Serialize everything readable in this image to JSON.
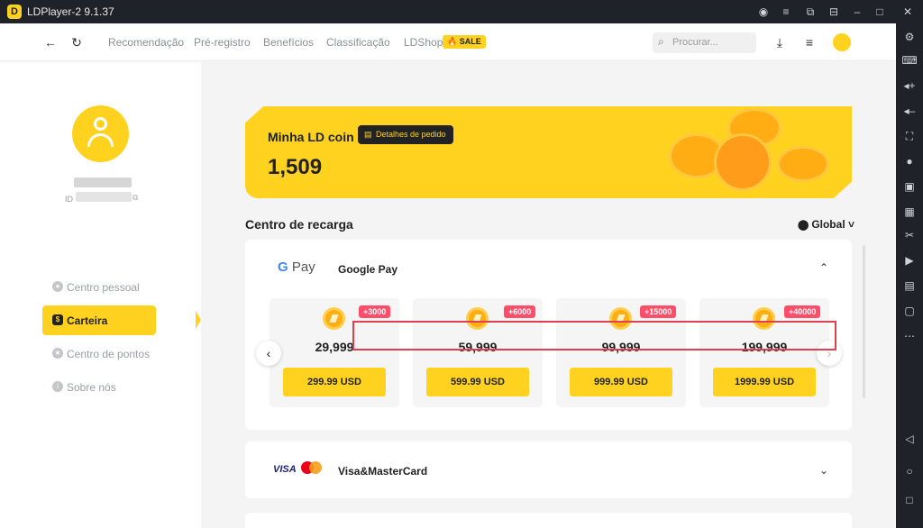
{
  "window": {
    "title": "LDPlayer-2 9.1.37",
    "logo_text": "D"
  },
  "nav": {
    "links": [
      "Recomendação",
      "Pré-registro",
      "Benefícios",
      "Classificação",
      "LDShop"
    ],
    "sale_badge": "SALE",
    "search_placeholder": "Procurar..."
  },
  "sidebar": {
    "id_label": "ID",
    "items": [
      {
        "label": "Centro pessoal",
        "active": false
      },
      {
        "label": "Carteira",
        "active": true
      },
      {
        "label": "Centro de pontos",
        "active": false
      },
      {
        "label": "Sobre nós",
        "active": false
      }
    ]
  },
  "coin_banner": {
    "title": "Minha LD coin",
    "detail_button": "Detalhes de pedido",
    "balance": "1,509"
  },
  "recharge": {
    "title": "Centro de recarga",
    "region": "Global",
    "google_pay": {
      "logo": "Pay",
      "logo_g": "G",
      "name": "Google Pay",
      "packages": [
        {
          "bonus": "+3000",
          "amount": "29,999",
          "price": "299.99 USD"
        },
        {
          "bonus": "+6000",
          "amount": "59,999",
          "price": "599.99 USD"
        },
        {
          "bonus": "+15000",
          "amount": "99,999",
          "price": "999.99 USD"
        },
        {
          "bonus": "+40000",
          "amount": "199,999",
          "price": "1999.99 USD"
        }
      ]
    },
    "card": {
      "logo": "VISA",
      "name": "Visa&MasterCard"
    }
  },
  "colors": {
    "accent": "#ffd21f",
    "bonus": "#ff4d6a",
    "highlight": "#e0404b",
    "chrome": "#1f2229"
  }
}
